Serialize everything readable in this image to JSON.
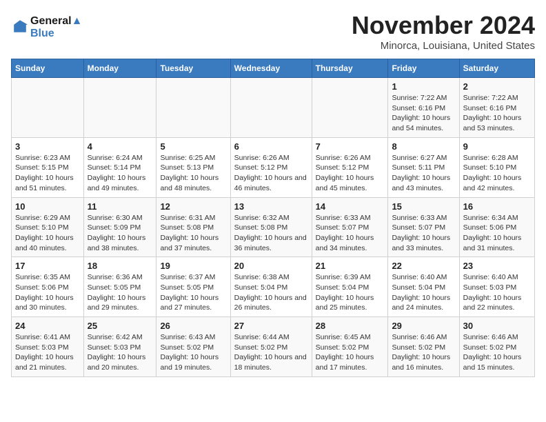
{
  "logo": {
    "line1": "General",
    "line2": "Blue"
  },
  "title": "November 2024",
  "subtitle": "Minorca, Louisiana, United States",
  "header": {
    "accent_color": "#3a7abf"
  },
  "days_of_week": [
    "Sunday",
    "Monday",
    "Tuesday",
    "Wednesday",
    "Thursday",
    "Friday",
    "Saturday"
  ],
  "weeks": [
    [
      {
        "day": "",
        "info": ""
      },
      {
        "day": "",
        "info": ""
      },
      {
        "day": "",
        "info": ""
      },
      {
        "day": "",
        "info": ""
      },
      {
        "day": "",
        "info": ""
      },
      {
        "day": "1",
        "info": "Sunrise: 7:22 AM\nSunset: 6:16 PM\nDaylight: 10 hours and 54 minutes."
      },
      {
        "day": "2",
        "info": "Sunrise: 7:22 AM\nSunset: 6:16 PM\nDaylight: 10 hours and 53 minutes."
      }
    ],
    [
      {
        "day": "3",
        "info": "Sunrise: 6:23 AM\nSunset: 5:15 PM\nDaylight: 10 hours and 51 minutes."
      },
      {
        "day": "4",
        "info": "Sunrise: 6:24 AM\nSunset: 5:14 PM\nDaylight: 10 hours and 49 minutes."
      },
      {
        "day": "5",
        "info": "Sunrise: 6:25 AM\nSunset: 5:13 PM\nDaylight: 10 hours and 48 minutes."
      },
      {
        "day": "6",
        "info": "Sunrise: 6:26 AM\nSunset: 5:12 PM\nDaylight: 10 hours and 46 minutes."
      },
      {
        "day": "7",
        "info": "Sunrise: 6:26 AM\nSunset: 5:12 PM\nDaylight: 10 hours and 45 minutes."
      },
      {
        "day": "8",
        "info": "Sunrise: 6:27 AM\nSunset: 5:11 PM\nDaylight: 10 hours and 43 minutes."
      },
      {
        "day": "9",
        "info": "Sunrise: 6:28 AM\nSunset: 5:10 PM\nDaylight: 10 hours and 42 minutes."
      }
    ],
    [
      {
        "day": "10",
        "info": "Sunrise: 6:29 AM\nSunset: 5:10 PM\nDaylight: 10 hours and 40 minutes."
      },
      {
        "day": "11",
        "info": "Sunrise: 6:30 AM\nSunset: 5:09 PM\nDaylight: 10 hours and 38 minutes."
      },
      {
        "day": "12",
        "info": "Sunrise: 6:31 AM\nSunset: 5:08 PM\nDaylight: 10 hours and 37 minutes."
      },
      {
        "day": "13",
        "info": "Sunrise: 6:32 AM\nSunset: 5:08 PM\nDaylight: 10 hours and 36 minutes."
      },
      {
        "day": "14",
        "info": "Sunrise: 6:33 AM\nSunset: 5:07 PM\nDaylight: 10 hours and 34 minutes."
      },
      {
        "day": "15",
        "info": "Sunrise: 6:33 AM\nSunset: 5:07 PM\nDaylight: 10 hours and 33 minutes."
      },
      {
        "day": "16",
        "info": "Sunrise: 6:34 AM\nSunset: 5:06 PM\nDaylight: 10 hours and 31 minutes."
      }
    ],
    [
      {
        "day": "17",
        "info": "Sunrise: 6:35 AM\nSunset: 5:06 PM\nDaylight: 10 hours and 30 minutes."
      },
      {
        "day": "18",
        "info": "Sunrise: 6:36 AM\nSunset: 5:05 PM\nDaylight: 10 hours and 29 minutes."
      },
      {
        "day": "19",
        "info": "Sunrise: 6:37 AM\nSunset: 5:05 PM\nDaylight: 10 hours and 27 minutes."
      },
      {
        "day": "20",
        "info": "Sunrise: 6:38 AM\nSunset: 5:04 PM\nDaylight: 10 hours and 26 minutes."
      },
      {
        "day": "21",
        "info": "Sunrise: 6:39 AM\nSunset: 5:04 PM\nDaylight: 10 hours and 25 minutes."
      },
      {
        "day": "22",
        "info": "Sunrise: 6:40 AM\nSunset: 5:04 PM\nDaylight: 10 hours and 24 minutes."
      },
      {
        "day": "23",
        "info": "Sunrise: 6:40 AM\nSunset: 5:03 PM\nDaylight: 10 hours and 22 minutes."
      }
    ],
    [
      {
        "day": "24",
        "info": "Sunrise: 6:41 AM\nSunset: 5:03 PM\nDaylight: 10 hours and 21 minutes."
      },
      {
        "day": "25",
        "info": "Sunrise: 6:42 AM\nSunset: 5:03 PM\nDaylight: 10 hours and 20 minutes."
      },
      {
        "day": "26",
        "info": "Sunrise: 6:43 AM\nSunset: 5:02 PM\nDaylight: 10 hours and 19 minutes."
      },
      {
        "day": "27",
        "info": "Sunrise: 6:44 AM\nSunset: 5:02 PM\nDaylight: 10 hours and 18 minutes."
      },
      {
        "day": "28",
        "info": "Sunrise: 6:45 AM\nSunset: 5:02 PM\nDaylight: 10 hours and 17 minutes."
      },
      {
        "day": "29",
        "info": "Sunrise: 6:46 AM\nSunset: 5:02 PM\nDaylight: 10 hours and 16 minutes."
      },
      {
        "day": "30",
        "info": "Sunrise: 6:46 AM\nSunset: 5:02 PM\nDaylight: 10 hours and 15 minutes."
      }
    ]
  ]
}
